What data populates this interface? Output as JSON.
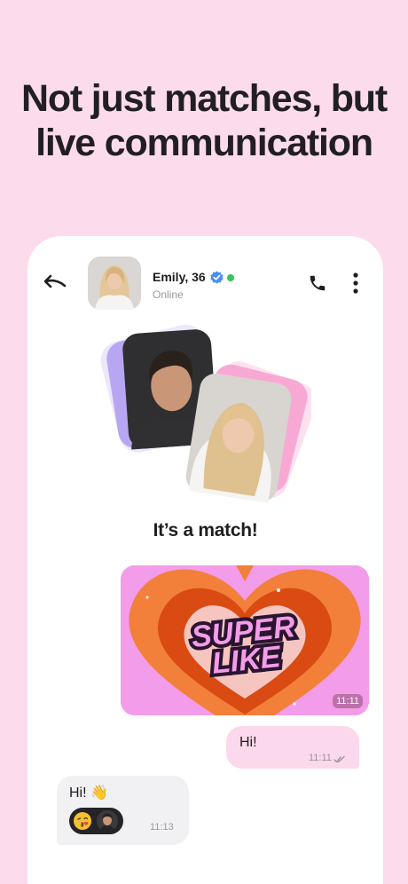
{
  "headline": {
    "line1": "Not just matches, but",
    "line2": "live communication"
  },
  "chat_header": {
    "name": "Emily, 36",
    "status": "Online",
    "verified_icon": "verified-badge-icon",
    "online_color": "#35c759"
  },
  "match": {
    "title": "It’s a match!"
  },
  "superlike": {
    "line1": "SUPER",
    "line2": "LIKE",
    "time": "11:11"
  },
  "messages": [
    {
      "direction": "outgoing",
      "text": "Hi!",
      "time": "11:11",
      "read_icon": "double-check-icon"
    },
    {
      "direction": "incoming",
      "text": "Hi! 👋",
      "time": "11:13",
      "reaction_icon": "kiss-emoji-icon"
    }
  ],
  "colors": {
    "background": "#fcdcec",
    "outgoing_bubble": "#fbd8eb",
    "incoming_bubble": "#f1f0f2",
    "superlike_orange": "#f2803a",
    "superlike_pink": "#f39ce9",
    "accent_purple": "#b9a6f2"
  }
}
